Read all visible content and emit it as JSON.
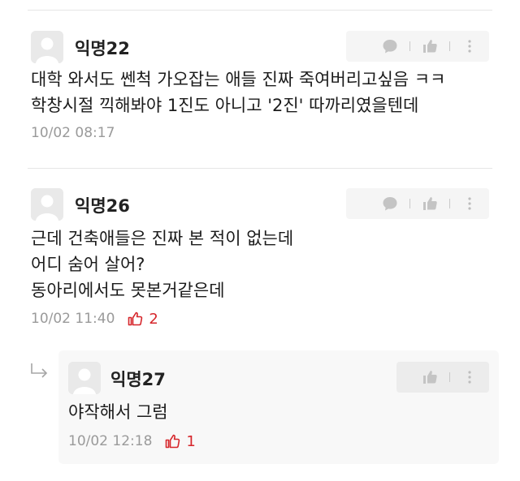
{
  "comments": [
    {
      "author": "익명22",
      "lines": [
        "대학 와서도 쎈척 가오잡는 애들 진짜 죽여버리고싶음 ㅋㅋ",
        "학창시절 끽해봐야 1진도 아니고 '2진' 따까리였을텐데"
      ],
      "time": "10/02 08:17",
      "likes": null
    },
    {
      "author": "익명26",
      "lines": [
        "근데 건축애들은 진짜 본 적이 없는데",
        "어디 숨어 살어?",
        "동아리에서도 못본거같은데"
      ],
      "time": "10/02 11:40",
      "likes": "2"
    }
  ],
  "reply": {
    "author": "익명27",
    "lines": [
      "야작해서 그럼"
    ],
    "time": "10/02 12:18",
    "likes": "1"
  },
  "colors": {
    "like_red": "#d6262b",
    "meta_gray": "#9a9a9a",
    "icon_gray": "#bdbdbd"
  }
}
